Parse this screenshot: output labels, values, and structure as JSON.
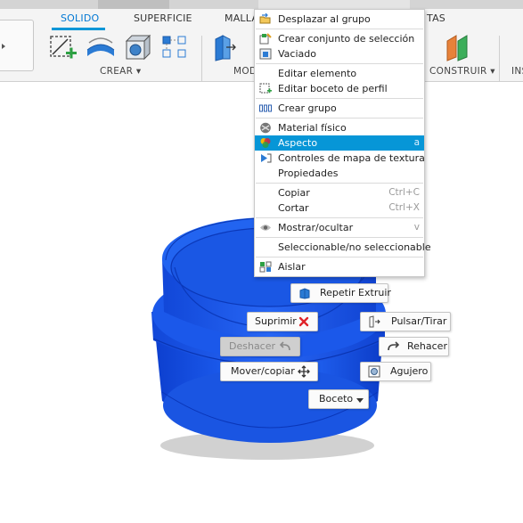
{
  "toolbar": {
    "tabs": [
      "SOLIDO",
      "SUPERFICIE",
      "MALLA",
      "TAS"
    ],
    "active_tab": "SOLIDO",
    "groups": {
      "crear": "CREAR ▾",
      "modificar": "MOD",
      "construir": "CONSTRUIR ▾",
      "insertar": "INS"
    }
  },
  "context_menu": {
    "items": [
      {
        "label": "Desplazar al grupo",
        "icon": "folder-move-icon",
        "shortcut": ""
      },
      {
        "separator": true
      },
      {
        "label": "Crear conjunto de selección",
        "icon": "selection-set-icon",
        "shortcut": ""
      },
      {
        "label": "Vaciado",
        "icon": "shell-icon",
        "shortcut": ""
      },
      {
        "separator": true
      },
      {
        "label": "Editar elemento",
        "icon": "",
        "shortcut": ""
      },
      {
        "label": "Editar boceto de perfil",
        "icon": "edit-sketch-icon",
        "shortcut": ""
      },
      {
        "separator": true
      },
      {
        "label": "Crear grupo",
        "icon": "group-icon",
        "shortcut": ""
      },
      {
        "separator": true
      },
      {
        "label": "Material físico",
        "icon": "physical-material-icon",
        "shortcut": ""
      },
      {
        "label": "Aspecto",
        "icon": "appearance-icon",
        "shortcut": "a",
        "highlighted": true
      },
      {
        "label": "Controles de mapa de textura",
        "icon": "texture-map-icon",
        "shortcut": ""
      },
      {
        "label": "Propiedades",
        "icon": "",
        "shortcut": ""
      },
      {
        "separator": true
      },
      {
        "label": "Copiar",
        "icon": "",
        "shortcut": "Ctrl+C"
      },
      {
        "label": "Cortar",
        "icon": "",
        "shortcut": "Ctrl+X"
      },
      {
        "separator": true
      },
      {
        "label": "Mostrar/ocultar",
        "icon": "eye-icon",
        "shortcut": "v"
      },
      {
        "separator": true
      },
      {
        "label": "Seleccionable/no seleccionable",
        "icon": "",
        "shortcut": ""
      },
      {
        "separator": true
      },
      {
        "label": "Aislar",
        "icon": "isolate-icon",
        "shortcut": ""
      }
    ]
  },
  "marking_menu": {
    "repetir_extruir": "Repetir Extruir",
    "suprimir": "Suprimir",
    "pulsar_tirar": "Pulsar/Tirar",
    "deshacer": "Deshacer",
    "rehacer": "Rehacer",
    "mover_copiar": "Mover/copiar",
    "agujero": "Agujero",
    "boceto": "Boceto"
  },
  "colors": {
    "accent": "#0696d7",
    "model_blue": "#1f5ee6",
    "model_dark": "#0b3fc4",
    "delete_red": "#e0242b"
  }
}
